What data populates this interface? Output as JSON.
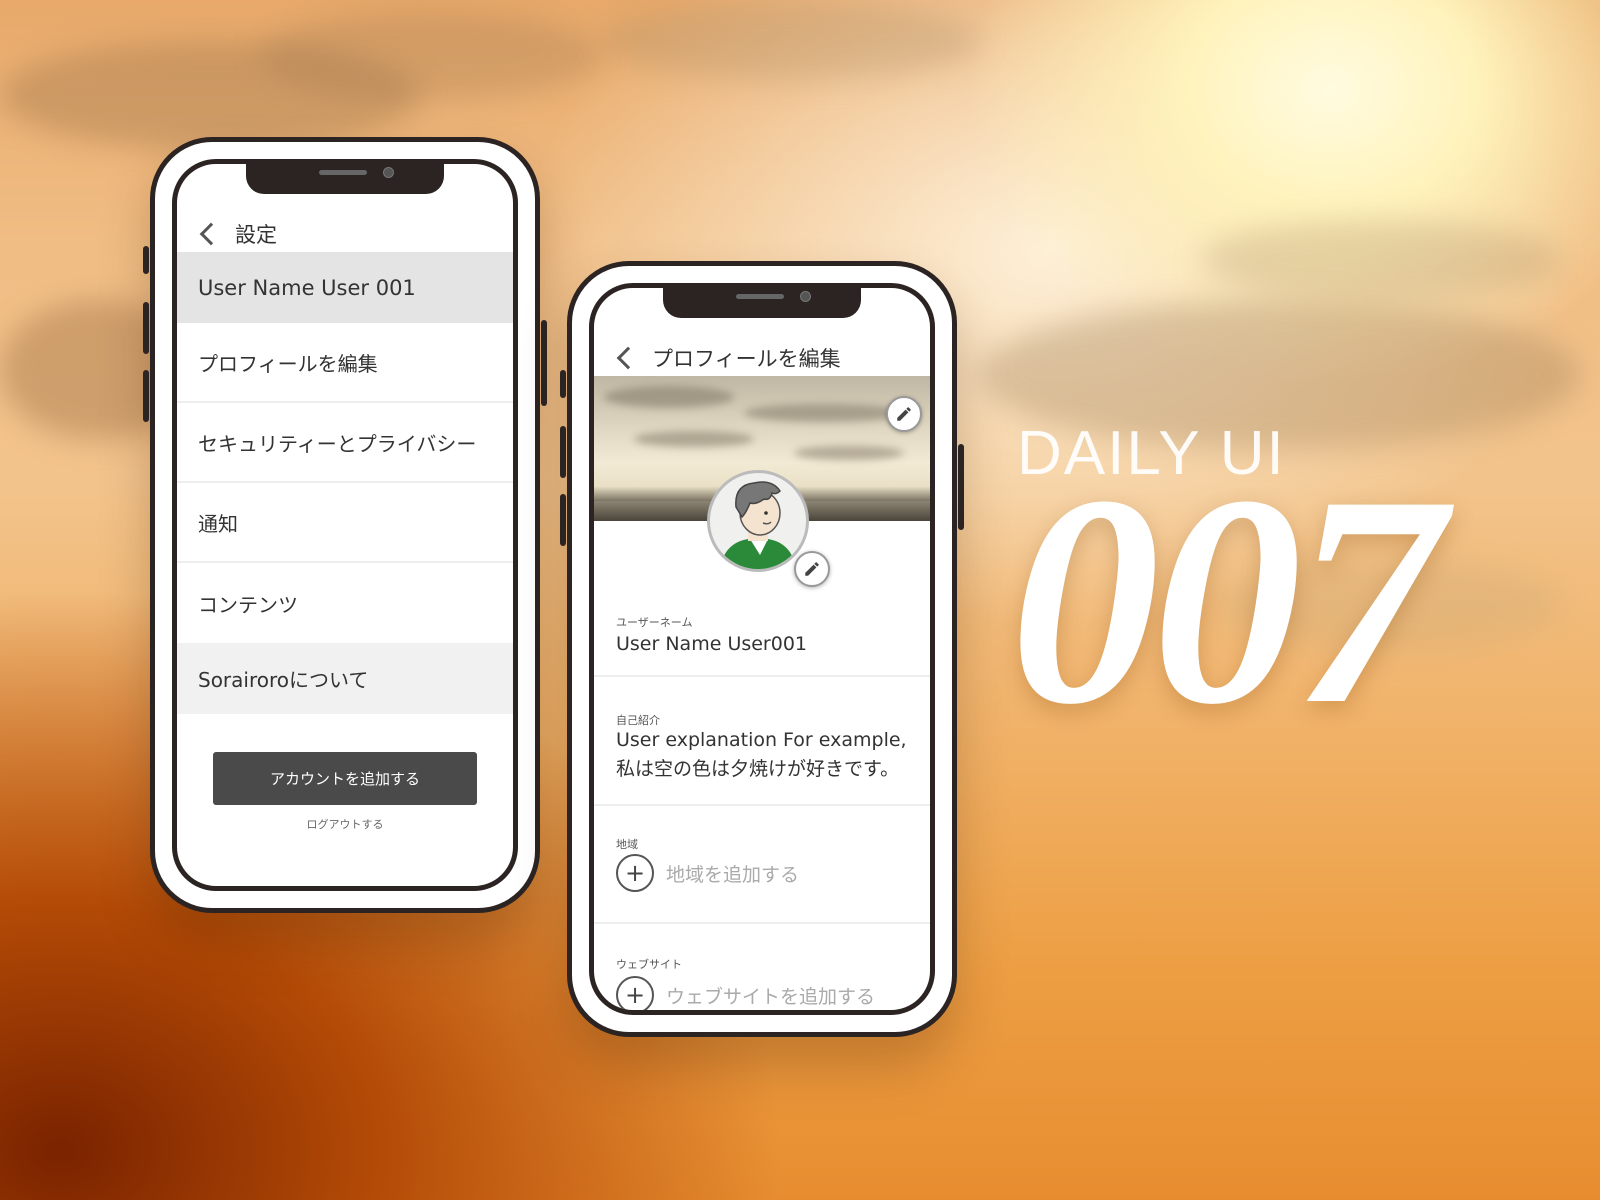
{
  "branding": {
    "daily_label": "DAILY UI",
    "number": "007"
  },
  "settings_phone": {
    "back_icon": "chevron-left-icon",
    "title": "設定",
    "user_name": "User Name User 001",
    "menu": [
      "プロフィールを編集",
      "セキュリティーとプライバシー",
      "通知",
      "コンテンツ",
      "Sorairoroについて"
    ],
    "add_account_label": "アカウントを追加する",
    "logout_label": "ログアウトする"
  },
  "profile_phone": {
    "back_icon": "chevron-left-icon",
    "title": "プロフィールを編集",
    "edit_icon": "pencil-icon",
    "username_label": "ユーザーネーム",
    "username_value": "User Name User001",
    "bio_label": "自己紹介",
    "bio_line1": "User explanation For example,",
    "bio_line2": "私は空の色は夕焼けが好きです。",
    "region_label": "地域",
    "region_placeholder": "地域を追加する",
    "website_label": "ウェブサイト",
    "website_placeholder": "ウェブサイトを追加する",
    "plus_icon": "plus-icon"
  },
  "colors": {
    "dark_frame": "#2b2422",
    "button": "#4a4a4a",
    "avatar_shirt": "#2a8a3a"
  }
}
